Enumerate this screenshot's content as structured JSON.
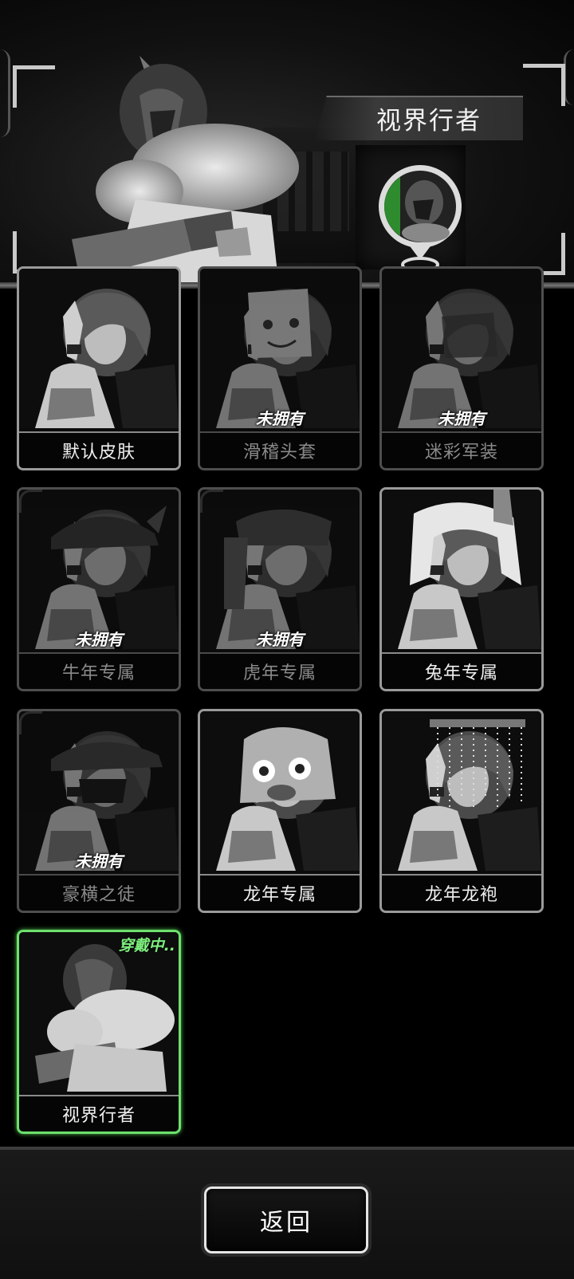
{
  "header": {
    "character_name": "视界行者"
  },
  "skins": [
    {
      "label": "默认皮肤",
      "owned": true,
      "status": ""
    },
    {
      "label": "滑稽头套",
      "owned": false,
      "status": "未拥有"
    },
    {
      "label": "迷彩军装",
      "owned": false,
      "status": "未拥有"
    },
    {
      "label": "牛年专属",
      "owned": false,
      "status": "未拥有"
    },
    {
      "label": "虎年专属",
      "owned": false,
      "status": "未拥有"
    },
    {
      "label": "兔年专属",
      "owned": true,
      "status": ""
    },
    {
      "label": "豪横之徒",
      "owned": false,
      "status": "未拥有"
    },
    {
      "label": "龙年专属",
      "owned": true,
      "status": ""
    },
    {
      "label": "龙年龙袍",
      "owned": true,
      "status": ""
    },
    {
      "label": "视界行者",
      "owned": true,
      "status": "穿戴中.."
    }
  ],
  "footer": {
    "back_label": "返回"
  },
  "colors": {
    "equipped_accent": "#6ee06e",
    "owned_border": "#9a9a9a",
    "locked_border": "#4e4e4e"
  },
  "icons": {
    "character_portrait": "character-portrait-icon",
    "avatar_pin": "location-pin-avatar-icon"
  }
}
